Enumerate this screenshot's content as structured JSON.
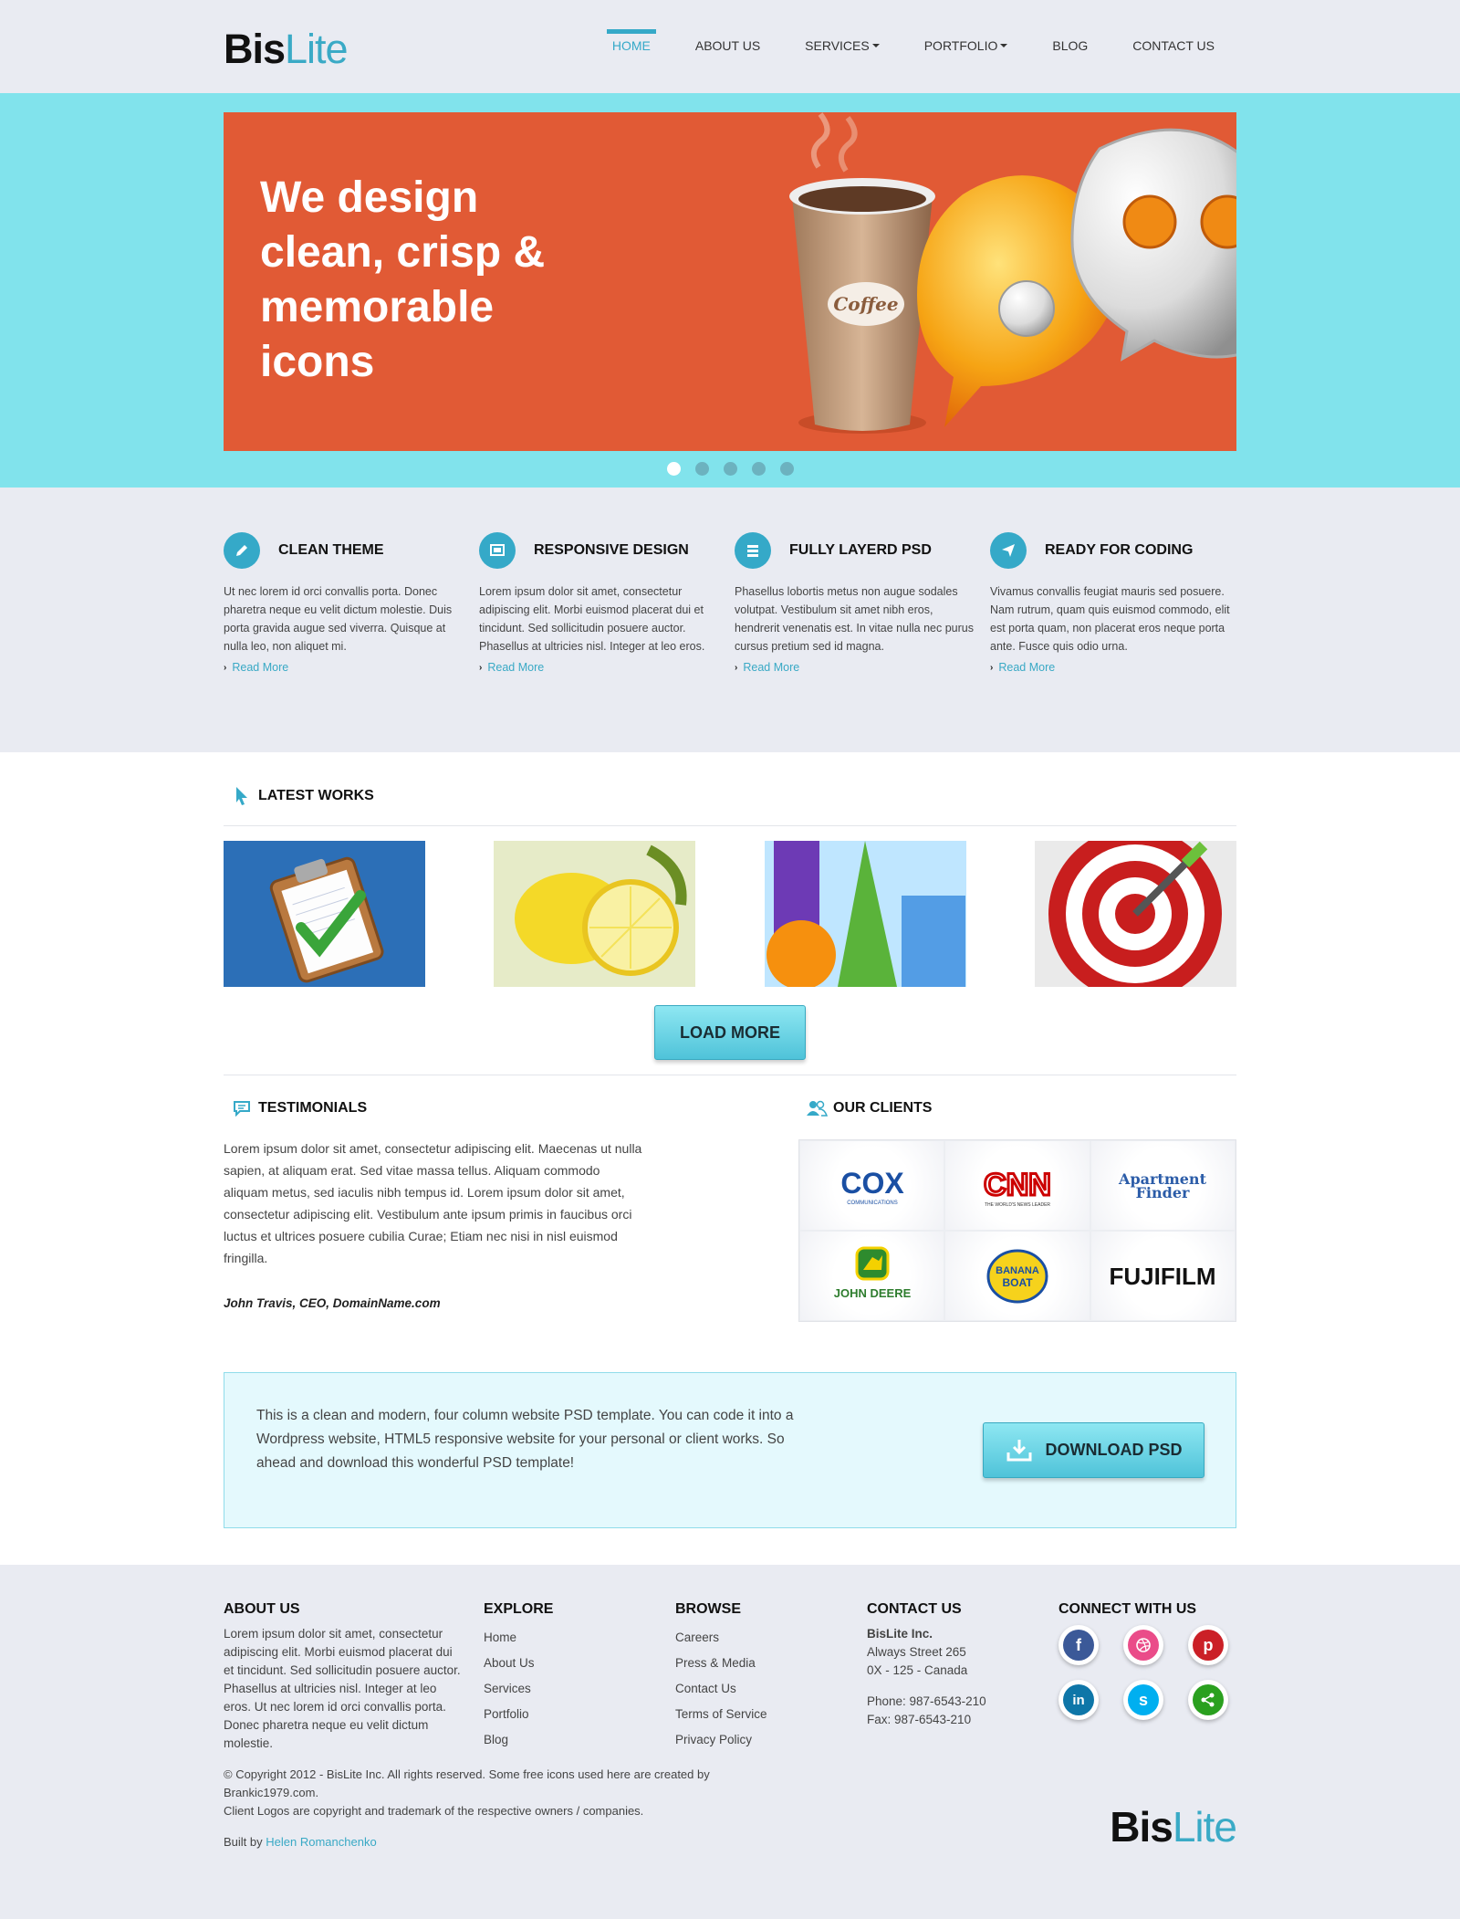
{
  "brand": {
    "bold": "Bis",
    "light": "Lite"
  },
  "nav": {
    "home": "HOME",
    "about": "ABOUT US",
    "services": "SERVICES",
    "portfolio": "PORTFOLIO",
    "blog": "BLOG",
    "contact": "CONTACT US"
  },
  "hero": {
    "headline": "We design clean, crisp & memorable icons",
    "cup_label": "Coffee",
    "slides_total": 5,
    "active_slide": 1
  },
  "features": [
    {
      "title": "CLEAN THEME",
      "icon": "pencil-icon",
      "text": "Ut nec lorem id orci convallis porta. Donec pharetra neque eu velit dictum molestie. Duis porta gravida augue sed viverra. Quisque at nulla leo, non aliquet mi.",
      "link": "Read More"
    },
    {
      "title": "RESPONSIVE DESIGN",
      "icon": "screen-icon",
      "text": "Lorem ipsum dolor sit amet, consectetur adipiscing elit. Morbi euismod placerat dui et tincidunt. Sed sollicitudin posuere auctor. Phasellus at ultricies nisl. Integer at leo eros.",
      "link": "Read More"
    },
    {
      "title": "FULLY LAYERD PSD",
      "icon": "layers-icon",
      "text": "Phasellus lobortis metus non augue sodales volutpat. Vestibulum sit amet nibh eros, hendrerit venenatis est. In vitae nulla nec purus cursus pretium sed id magna.",
      "link": "Read More"
    },
    {
      "title": "READY FOR CODING",
      "icon": "paper-plane-icon",
      "text": "Vivamus convallis feugiat mauris sed posuere. Nam rutrum, quam quis euismod commodo, elit est porta quam, non placerat eros neque porta ante. Fusce quis odio urna.",
      "link": "Read More"
    }
  ],
  "works": {
    "title": "LATEST WORKS",
    "load_more": "LOAD MORE"
  },
  "testimonials": {
    "title": "TESTIMONIALS",
    "text": "Lorem ipsum dolor sit amet, consectetur adipiscing elit. Maecenas ut nulla sapien, at aliquam erat. Sed vitae massa tellus. Aliquam commodo aliquam metus, sed iaculis nibh tempus id. Lorem ipsum dolor sit amet, consectetur adipiscing elit. Vestibulum ante ipsum primis in faucibus orci luctus et ultrices posuere cubilia Curae; Etiam nec nisi in nisl euismod fringilla.",
    "author": "John Travis, CEO, DomainName.com"
  },
  "clients": {
    "title": "OUR CLIENTS",
    "logos": {
      "cox": "COX",
      "cox_sub": "COMMUNICATIONS",
      "cnn": "CNN",
      "cnn_sub": "THE WORLD'S NEWS LEADER",
      "apt1": "Apartment",
      "apt2": "Finder",
      "deere": "JOHN DEERE",
      "banana1": "BANANA",
      "banana2": "BOAT",
      "fuji": "FUJIFILM"
    }
  },
  "cta": {
    "text": "This is a clean and modern, four column website PSD template. You can code it into a Wordpress website, HTML5 responsive website for your personal or client works. So ahead and download this wonderful PSD template!",
    "button": "DOWNLOAD PSD"
  },
  "footer": {
    "about_title": "ABOUT US",
    "about_text": "Lorem ipsum dolor sit amet, consectetur adipiscing elit. Morbi euismod placerat dui et tincidunt. Sed sollicitudin posuere auctor. Phasellus at ultricies nisl. Integer at leo eros. Ut nec lorem id orci convallis porta. Donec pharetra neque eu velit dictum molestie.",
    "explore_title": "EXPLORE",
    "explore": [
      "Home",
      "About Us",
      "Services",
      "Portfolio",
      "Blog"
    ],
    "browse_title": "BROWSE",
    "browse": [
      "Careers",
      "Press & Media",
      "Contact Us",
      "Terms of Service",
      "Privacy Policy"
    ],
    "contact_title": "CONTACT US",
    "company": "BisLite Inc.",
    "street": "Always Street 265",
    "city": "0X - 125 - Canada",
    "phone": "Phone: 987-6543-210",
    "fax": "Fax: 987-6543-210",
    "connect_title": "CONNECT WITH US",
    "copyright1": "© Copyright 2012 - BisLite Inc. All rights reserved. Some free icons used here are created by Brankic1979.com.",
    "copyright2": "Client Logos are copyright and trademark of the respective owners / companies.",
    "built_by": "Built by",
    "author": "Helen Romanchenko"
  },
  "colors": {
    "accent": "#35a9c8",
    "hero_bg": "#81e3ec",
    "slide_bg": "#e15a35",
    "page_bg": "#e9ebf2"
  }
}
